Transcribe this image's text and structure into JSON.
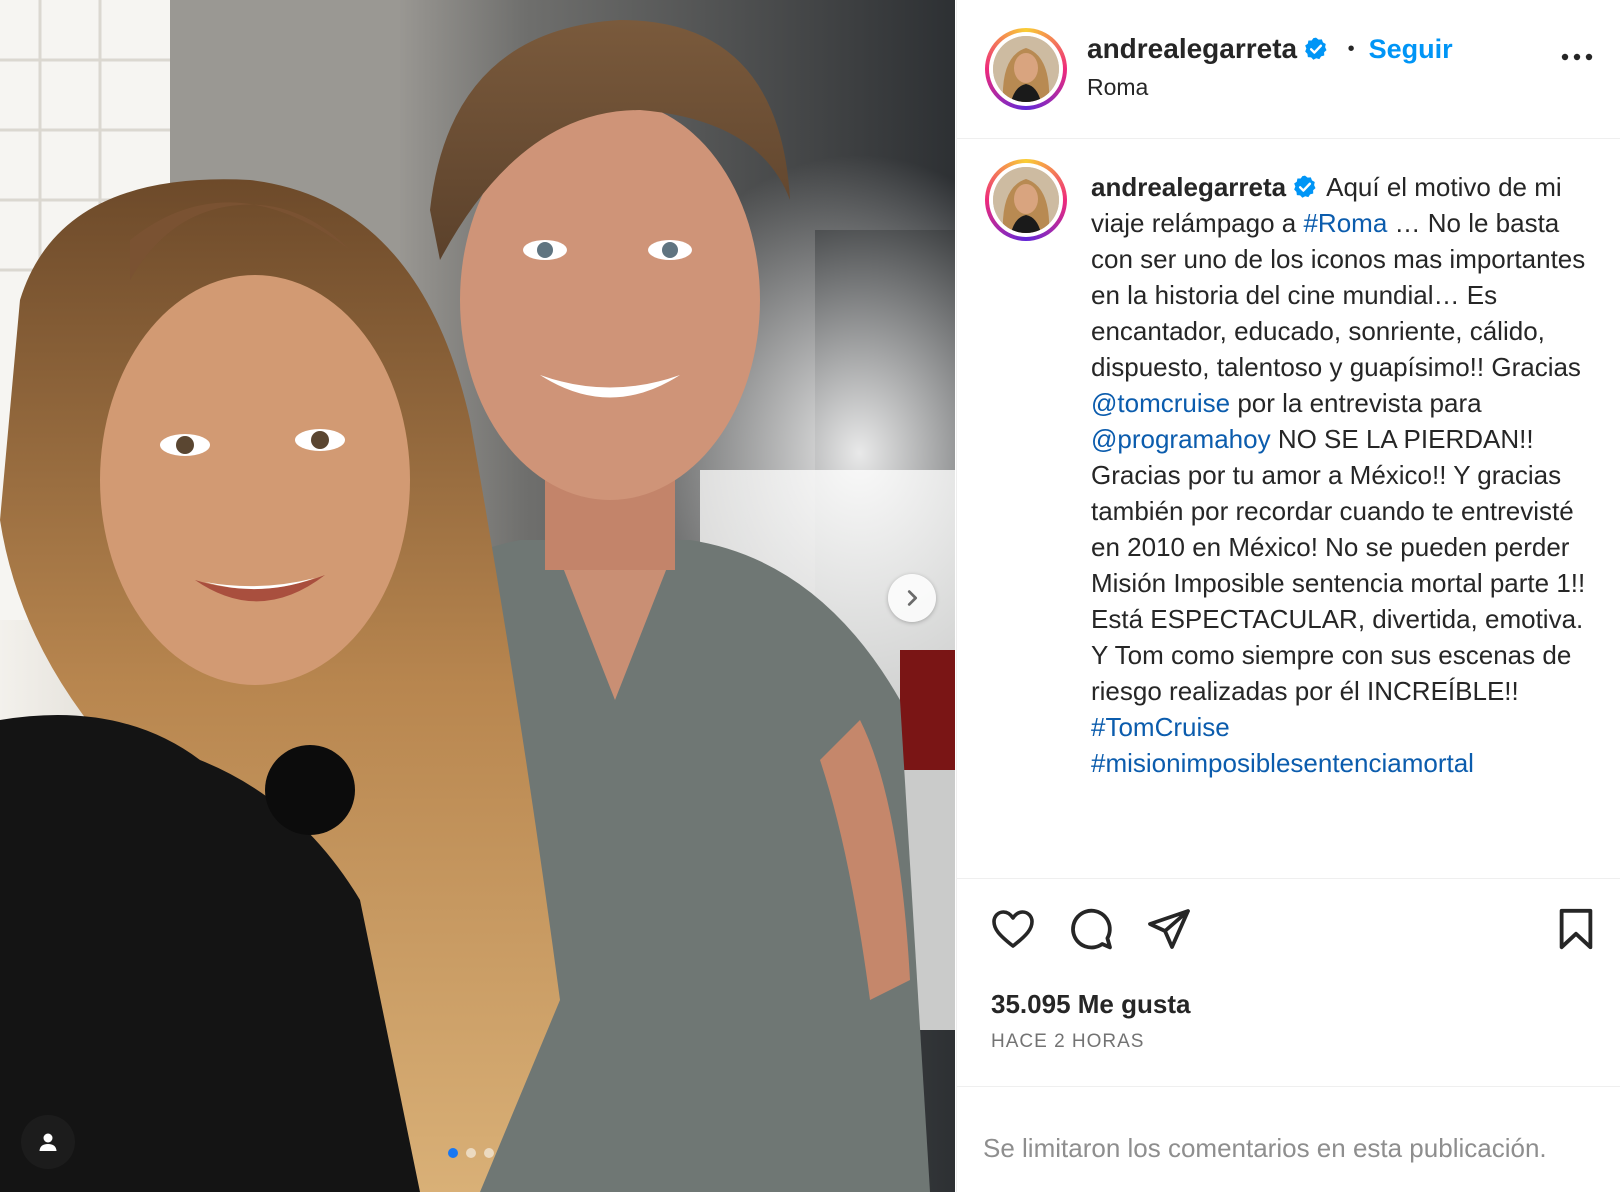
{
  "post": {
    "username": "andrealegarreta",
    "location": "Roma",
    "follow_label": "Seguir",
    "separator": "•",
    "caption_segments": [
      {
        "text": "Aquí el motivo de mi viaje relámpago a ",
        "link": false
      },
      {
        "text": "#Roma",
        "link": true
      },
      {
        "text": " … No le basta con ser uno de los iconos mas importantes en la historia del cine mundial… Es encantador, educado, sonriente, cálido, dispuesto, talentoso y guapísimo!! Gracias ",
        "link": false
      },
      {
        "text": "@tomcruise",
        "link": true
      },
      {
        "text": " por la entrevista para ",
        "link": false
      },
      {
        "text": "@programahoy",
        "link": true
      },
      {
        "text": " NO SE LA PIERDAN!! Gracias por tu amor a México!! Y gracias también por recordar cuando te entrevisté en 2010 en México! No se pueden perder Misión Imposible sentencia mortal parte 1!! Está ESPECTACULAR, divertida, emotiva. Y Tom como siempre con sus escenas de riesgo realizadas por él INCREÍBLE!! ",
        "link": false
      },
      {
        "text": "#TomCruise",
        "link": true
      },
      {
        "text": " ",
        "link": false
      },
      {
        "text": "#misionimposiblesentenciamortal",
        "link": true
      }
    ],
    "likes": "35.095 Me gusta",
    "time": "HACE 2 HORAS",
    "comments_limited": "Se limitaron los comentarios en esta publicación."
  },
  "carousel": {
    "total": 3,
    "active_index": 0
  },
  "icons": {
    "verified": "verified-badge-icon",
    "more": "more-options-icon",
    "like": "heart-icon",
    "comment": "comment-icon",
    "share": "send-icon",
    "save": "bookmark-icon",
    "next": "chevron-right-icon",
    "tagged": "user-tag-icon"
  },
  "colors": {
    "link": "#0095f6",
    "verified": "#0095f6",
    "muted": "#737373",
    "text": "#262626"
  }
}
